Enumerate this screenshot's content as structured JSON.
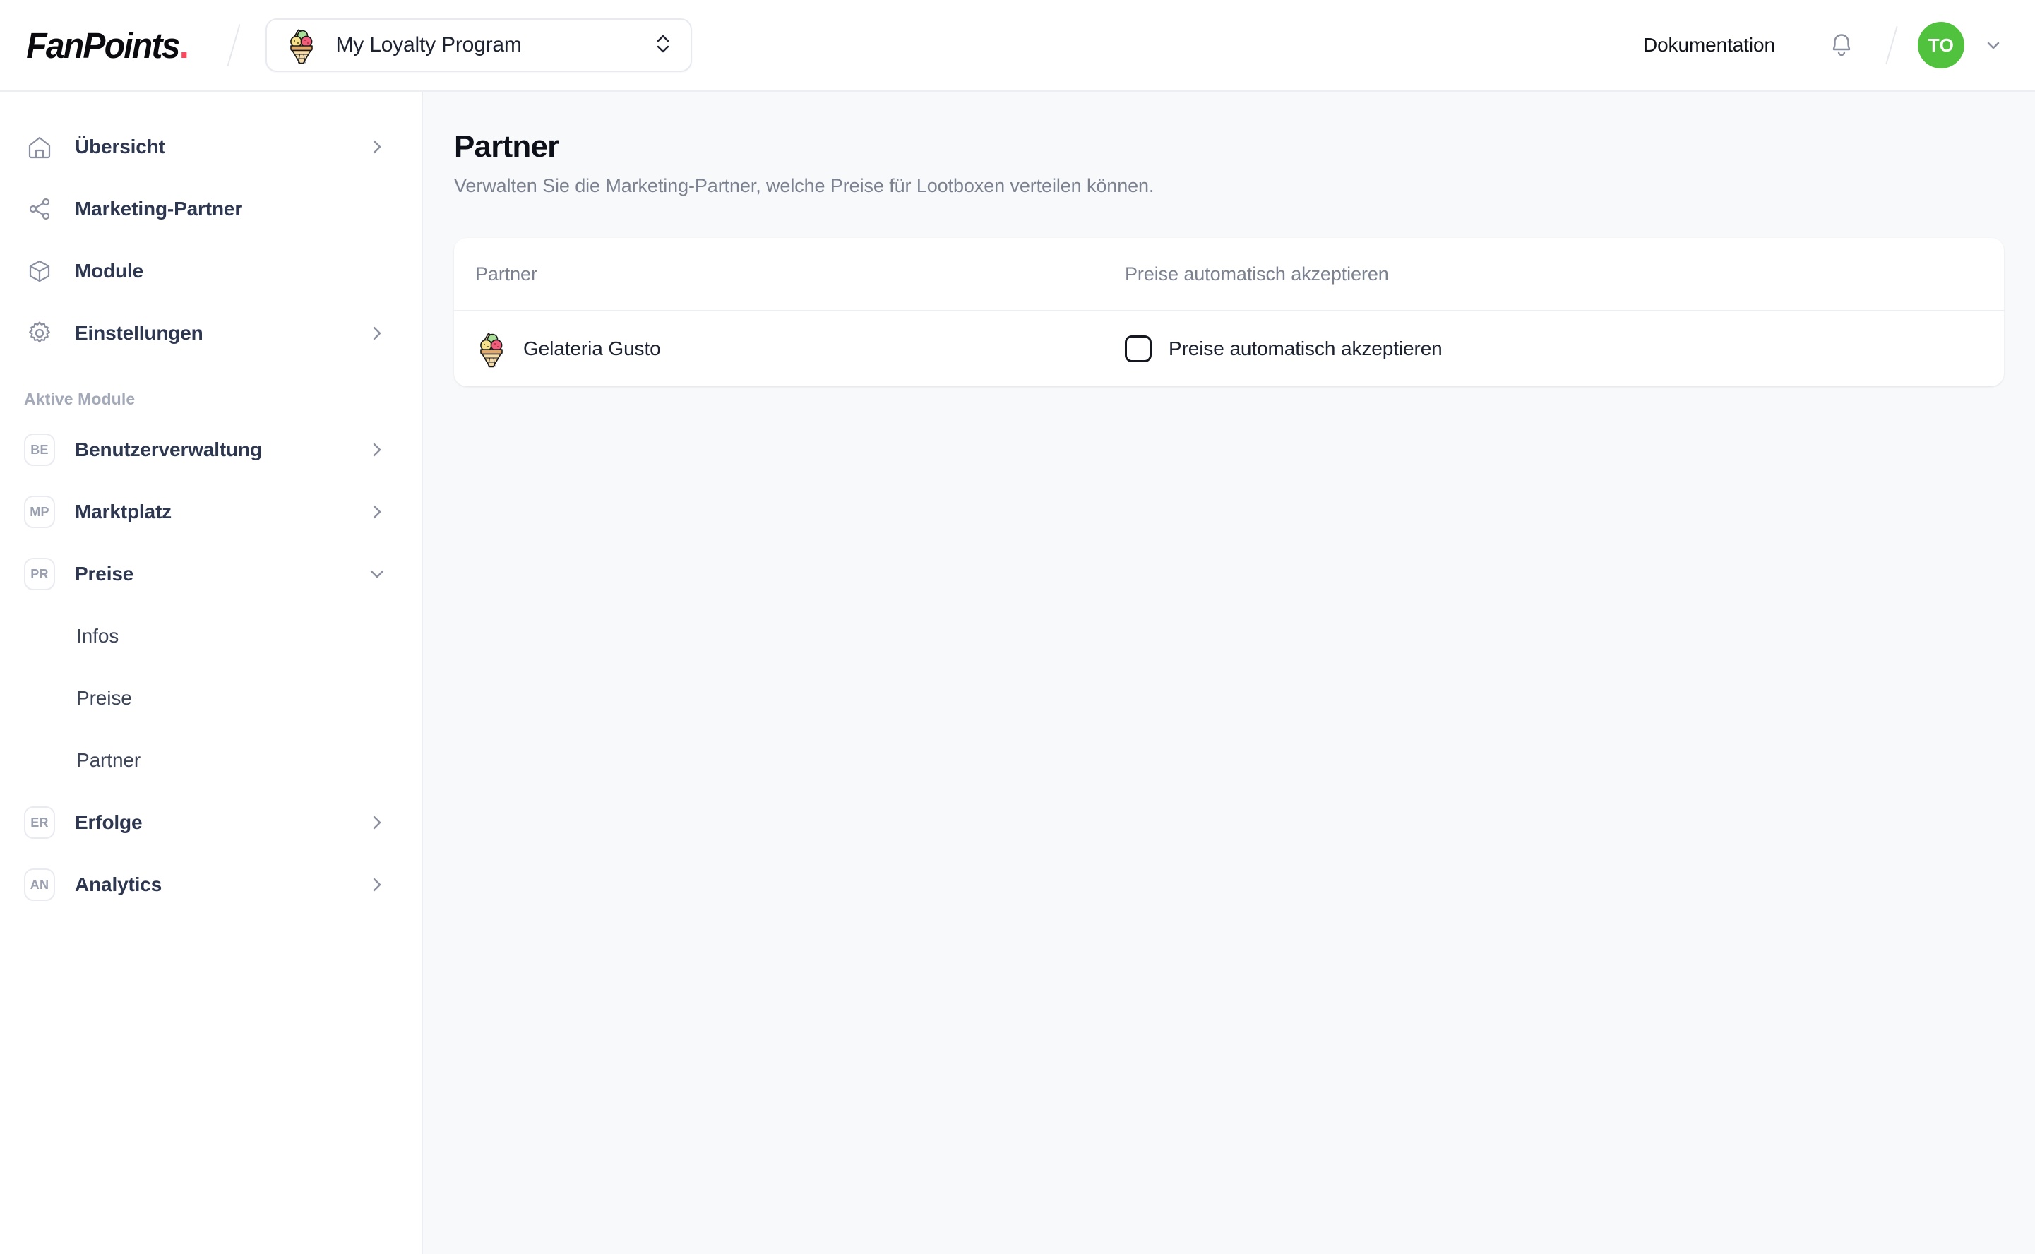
{
  "header": {
    "logo_text": "FanPoints",
    "logo_dot": ".",
    "program_selector": {
      "icon": "ice-cream-cone-icon",
      "value": "My Loyalty Program"
    },
    "documentation_link": "Dokumentation",
    "notifications_icon": "bell-icon",
    "avatar_initials": "TO",
    "avatar_color": "#51c23d",
    "account_caret_icon": "chevron-down-icon"
  },
  "sidebar": {
    "primary_items": [
      {
        "label": "Übersicht",
        "icon": "home-icon",
        "caret": "chevron-right-icon",
        "has_caret": true
      },
      {
        "label": "Marketing-Partner",
        "icon": "share-icon",
        "caret": "",
        "has_caret": false
      },
      {
        "label": "Module",
        "icon": "cube-icon",
        "caret": "",
        "has_caret": false
      },
      {
        "label": "Einstellungen",
        "icon": "gear-icon",
        "caret": "chevron-right-icon",
        "has_caret": true
      }
    ],
    "section_title": "Aktive Module",
    "module_items": [
      {
        "label": "Benutzerverwaltung",
        "badge": "BE",
        "caret": "chevron-right-icon",
        "expanded": false
      },
      {
        "label": "Marktplatz",
        "badge": "MP",
        "caret": "chevron-right-icon",
        "expanded": false
      },
      {
        "label": "Preise",
        "badge": "PR",
        "caret": "chevron-down-icon",
        "expanded": true
      }
    ],
    "preise_subitems": [
      {
        "label": "Infos"
      },
      {
        "label": "Preise"
      },
      {
        "label": "Partner"
      }
    ],
    "module_items_after": [
      {
        "label": "Erfolge",
        "badge": "ER",
        "caret": "chevron-right-icon",
        "expanded": false
      },
      {
        "label": "Analytics",
        "badge": "AN",
        "caret": "chevron-right-icon",
        "expanded": false
      }
    ]
  },
  "main": {
    "title": "Partner",
    "subtitle": "Verwalten Sie die Marketing-Partner, welche Preise für Lootboxen verteilen können.",
    "table": {
      "columns": [
        {
          "label": "Partner"
        },
        {
          "label": "Preise automatisch akzeptieren"
        }
      ],
      "rows": [
        {
          "partner_icon": "ice-cream-cone-icon",
          "partner_name": "Gelateria Gusto",
          "auto_accept_label": "Preise automatisch akzeptieren",
          "auto_accept_checked": false
        }
      ]
    }
  }
}
